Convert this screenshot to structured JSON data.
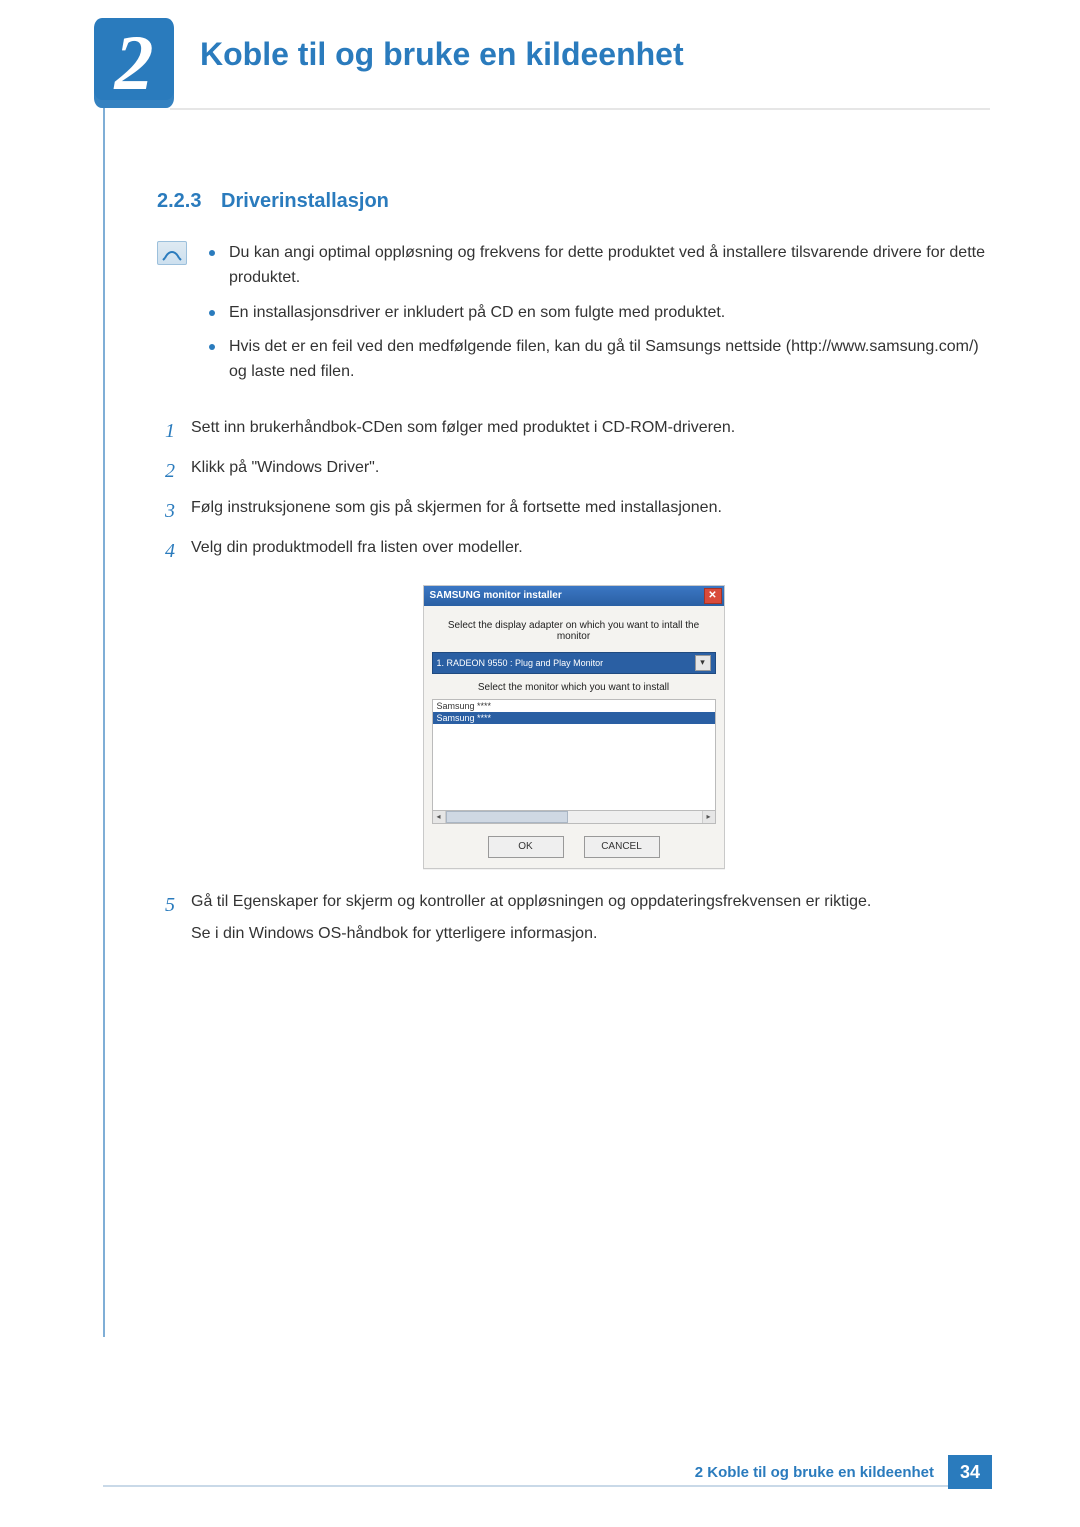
{
  "chapter": {
    "number": "2",
    "title": "Koble til og bruke en kildeenhet"
  },
  "section": {
    "number": "2.2.3",
    "title": "Driverinstallasjon"
  },
  "notes": [
    "Du kan angi optimal oppløsning og frekvens for dette produktet ved å installere tilsvarende drivere for dette produktet.",
    "En installasjonsdriver er inkludert på CD en som fulgte med produktet.",
    "Hvis det er en feil ved den medfølgende filen, kan du gå til Samsungs nettside (http://www.samsung.com/) og laste ned filen."
  ],
  "steps": [
    {
      "n": "1",
      "t": "Sett inn brukerhåndbok-CDen som følger med produktet i CD-ROM-driveren."
    },
    {
      "n": "2",
      "t": "Klikk på \"Windows Driver\"."
    },
    {
      "n": "3",
      "t": "Følg instruksjonene som gis på skjermen for å fortsette med installasjonen."
    },
    {
      "n": "4",
      "t": "Velg din produktmodell fra listen over modeller."
    },
    {
      "n": "5",
      "t": "Gå til Egenskaper for skjerm og kontroller at oppløsningen og oppdateringsfrekvensen er riktige.",
      "sub": "Se i din Windows OS-håndbok for ytterligere informasjon."
    }
  ],
  "installer": {
    "title": "SAMSUNG monitor installer",
    "instr1": "Select the display adapter on which you want to intall the monitor",
    "adapter": "1. RADEON 9550 : Plug and Play Monitor",
    "instr2": "Select the monitor which you want to install",
    "items": [
      "Samsung ****",
      "Samsung ****"
    ],
    "ok": "OK",
    "cancel": "CANCEL"
  },
  "footer": {
    "text": "2 Koble til og bruke en kildeenhet",
    "page": "34"
  }
}
